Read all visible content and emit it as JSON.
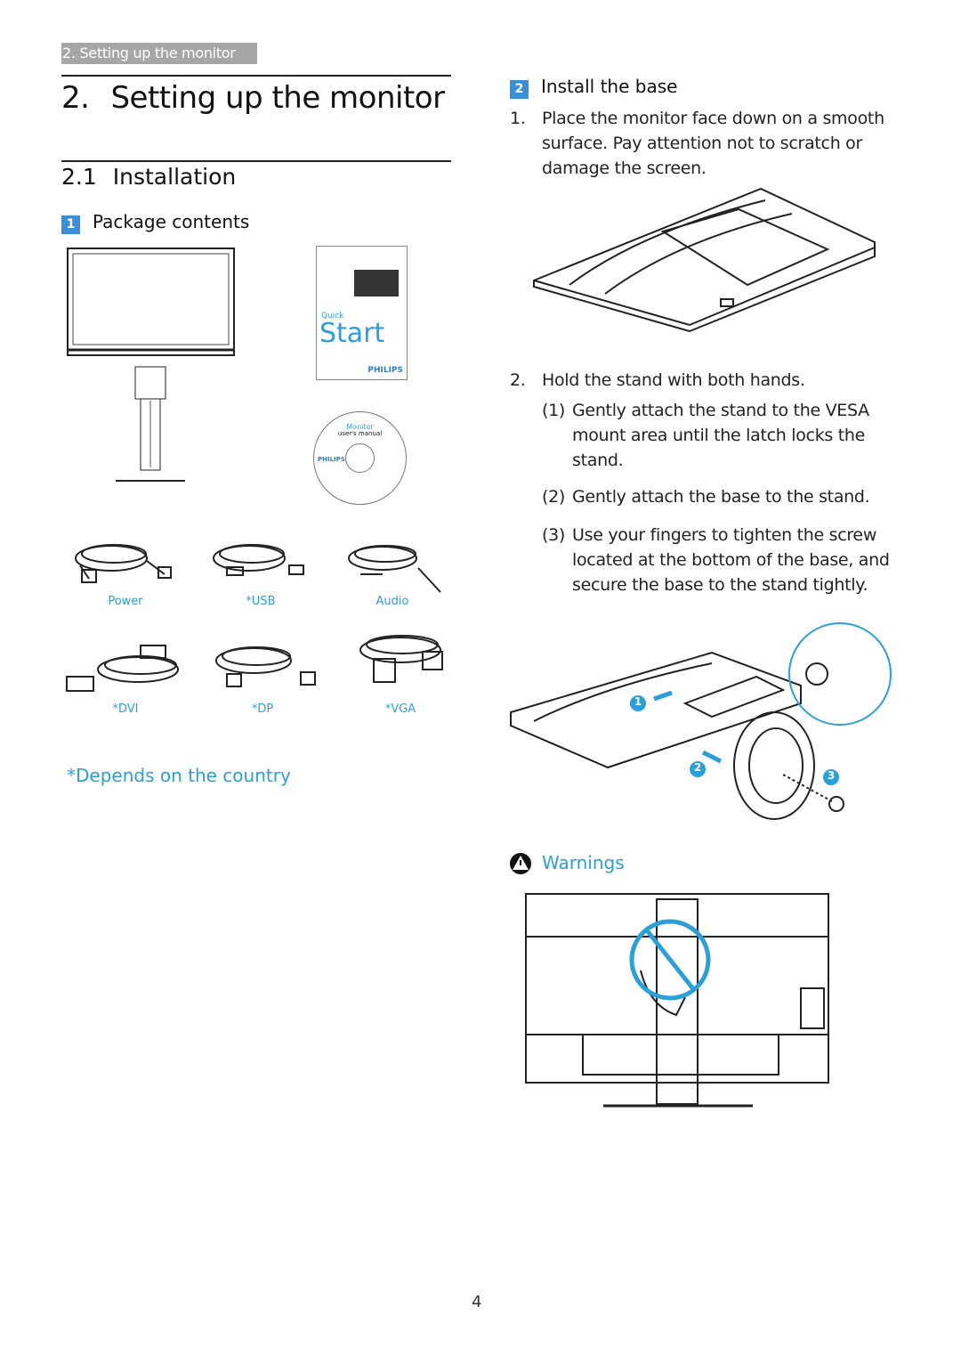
{
  "running_header": "2. Setting up the monitor",
  "chapter": {
    "number": "2.",
    "title": "Setting up the monitor"
  },
  "section": {
    "number": "2.1",
    "title": "Installation"
  },
  "package": {
    "badge": "1",
    "title": "Package contents",
    "quick_start": {
      "small": "Quick",
      "big": "Start",
      "brand": "PHILIPS"
    },
    "cd": {
      "line1": "Monitor",
      "line2": "user's manual",
      "brand": "PHILIPS"
    },
    "cables": [
      "Power",
      "*USB",
      "Audio",
      "*DVI",
      "*DP",
      "*VGA"
    ],
    "note": "*Depends on the country"
  },
  "install_base": {
    "badge": "2",
    "title": "Install the base",
    "step1_num": "1.",
    "step1": "Place the monitor face down on a smooth surface. Pay attention not to scratch or damage the screen.",
    "step2_num": "2.",
    "step2": "Hold the stand with both hands.",
    "substeps": [
      {
        "num": "(1)",
        "text": "Gently attach the stand to the VESA mount area until the latch locks the stand."
      },
      {
        "num": "(2)",
        "text": "Gently attach the base to the stand."
      },
      {
        "num": "(3)",
        "text": "Use your fingers to tighten the screw located at the bottom of the base, and secure the base to the stand tightly."
      }
    ],
    "callouts": [
      "1",
      "2",
      "3"
    ]
  },
  "warnings": {
    "title": "Warnings",
    "icon": "warning-triangle-icon"
  },
  "page_number": "4",
  "colors": {
    "accent": "#2a9fd8",
    "badge": "#3a8fd8",
    "header_bar": "#a6a6a6"
  }
}
